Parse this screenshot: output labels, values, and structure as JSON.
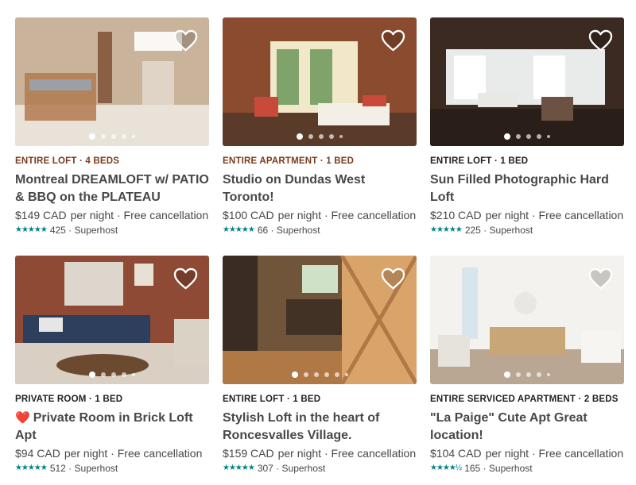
{
  "listings": [
    {
      "kind": "ENTIRE LOFT · 4 BEDS",
      "kind_color": "#7a3b1c",
      "title": "Montreal DREAMLOFT w/ PATIO & BBQ on the PLATEAU",
      "title_icon": "",
      "price": "$149 CAD",
      "per_night": "per night · Free cancellation",
      "stars": "★★★★★",
      "reviews": "425 · Superhost",
      "photo_count": 5,
      "active_photo": 0,
      "palette": [
        "#c9b39a",
        "#7a4a2e",
        "#e9e2d8",
        "#b07a4f"
      ]
    },
    {
      "kind": "ENTIRE APARTMENT · 1 BED",
      "kind_color": "#7a3b1c",
      "title": "Studio on Dundas West Toronto!",
      "title_icon": "",
      "price": "$100 CAD",
      "per_night": "per night · Free cancellation",
      "stars": "★★★★★",
      "reviews": "66 · Superhost",
      "photo_count": 5,
      "active_photo": 0,
      "palette": [
        "#8a4b2e",
        "#f1e7c9",
        "#c84a3a",
        "#5a3a28"
      ]
    },
    {
      "kind": "ENTIRE LOFT · 1 BED",
      "kind_color": "#222222",
      "title": "Sun Filled Photographic Hard Loft",
      "title_icon": "",
      "price": "$210 CAD",
      "per_night": "per night · Free cancellation",
      "stars": "★★★★★",
      "reviews": "225 · Superhost",
      "photo_count": 5,
      "active_photo": 0,
      "palette": [
        "#3a2a22",
        "#e8ebe9",
        "#6b5242",
        "#2a1e18"
      ]
    },
    {
      "kind": "PRIVATE ROOM · 1 BED",
      "kind_color": "#222222",
      "title": "Private Room in Brick Loft Apt",
      "title_icon": "❤️",
      "price": "$94 CAD",
      "per_night": "per night · Free cancellation",
      "stars": "★★★★★",
      "reviews": "512 · Superhost",
      "photo_count": 5,
      "active_photo": 0,
      "palette": [
        "#8e4a34",
        "#2d3f5c",
        "#d9cfc2",
        "#6b4a30"
      ]
    },
    {
      "kind": "ENTIRE LOFT · 1 BED",
      "kind_color": "#222222",
      "title": "Stylish Loft in the heart of Roncesvalles Village.",
      "title_icon": "",
      "price": "$159 CAD",
      "per_night": "per night · Free cancellation",
      "stars": "★★★★★",
      "reviews": "307 · Superhost",
      "photo_count": 6,
      "active_photo": 0,
      "palette": [
        "#b07845",
        "#3a2c22",
        "#d9a46a",
        "#efe7d8"
      ]
    },
    {
      "kind": "ENTIRE SERVICED APARTMENT · 2 BEDS",
      "kind_color": "#222222",
      "title": "\"La Paige\" Cute Apt Great location!",
      "title_icon": "",
      "price": "$104 CAD",
      "per_night": "per night · Free cancellation",
      "stars": "★★★★½",
      "reviews": "165 · Superhost",
      "photo_count": 5,
      "active_photo": 0,
      "palette": [
        "#f4f2ee",
        "#c9a678",
        "#e6e2dc",
        "#8a6a48"
      ]
    }
  ],
  "colors": {
    "text": "#484848",
    "stars": "#008489"
  }
}
